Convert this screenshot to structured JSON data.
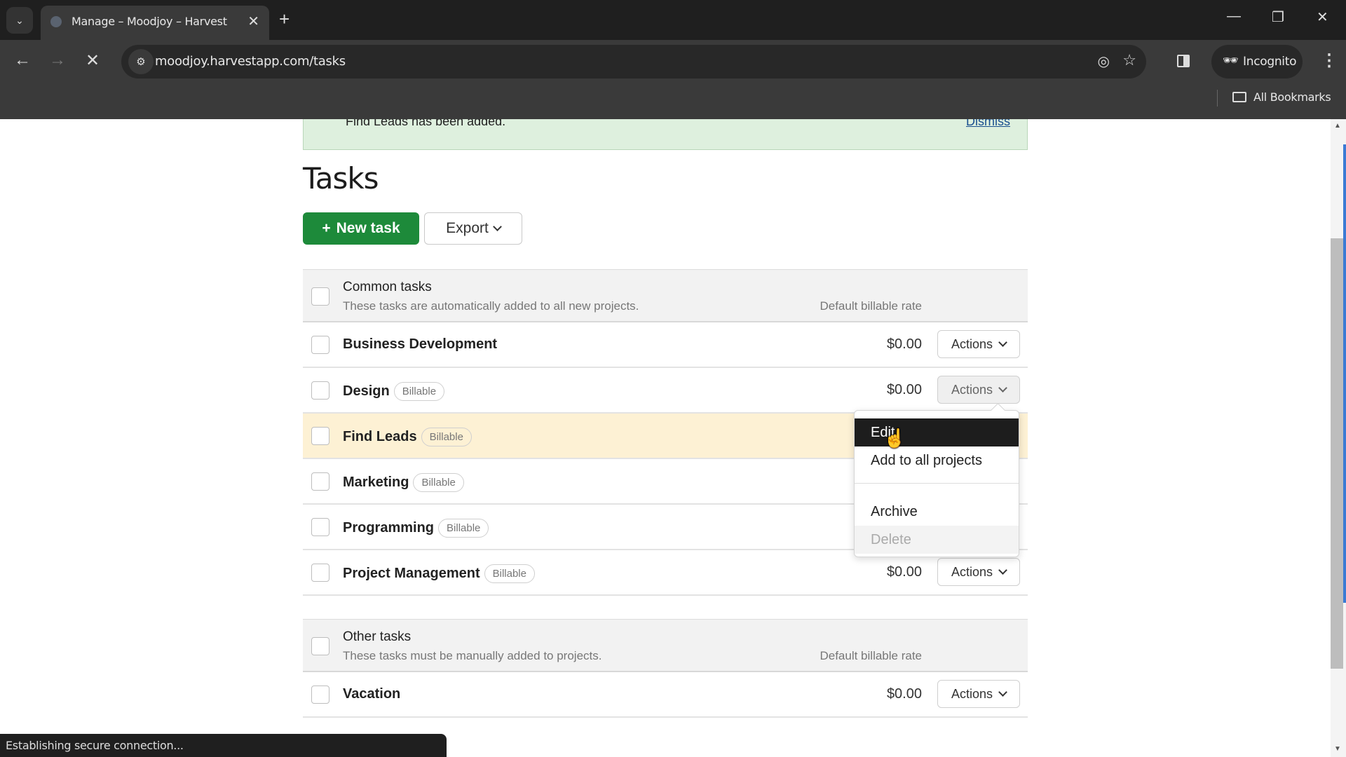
{
  "browser": {
    "tab_title": "Manage – Moodjoy – Harvest",
    "url": "moodjoy.harvestapp.com/tasks",
    "profile_label": "Incognito",
    "bookmarks_label": "All Bookmarks",
    "status_text": "Establishing secure connection..."
  },
  "banner": {
    "message": "Find Leads has been added.",
    "dismiss_label": "Dismiss"
  },
  "page": {
    "title": "Tasks",
    "new_task_label": "New task",
    "export_label": "Export"
  },
  "common_tasks": {
    "title": "Common tasks",
    "description": "These tasks are automatically added to all new projects.",
    "rate_header": "Default billable rate",
    "rows": [
      {
        "name": "Business Development",
        "badge": "",
        "rate": "$0.00",
        "actions": "Actions"
      },
      {
        "name": "Design",
        "badge": "Billable",
        "rate": "$0.00",
        "actions": "Actions"
      },
      {
        "name": "Find Leads",
        "badge": "Billable",
        "rate": "",
        "actions": ""
      },
      {
        "name": "Marketing",
        "badge": "Billable",
        "rate": "",
        "actions": ""
      },
      {
        "name": "Programming",
        "badge": "Billable",
        "rate": "",
        "actions": ""
      },
      {
        "name": "Project Management",
        "badge": "Billable",
        "rate": "$0.00",
        "actions": "Actions"
      }
    ]
  },
  "other_tasks": {
    "title": "Other tasks",
    "description": "These tasks must be manually added to projects.",
    "rate_header": "Default billable rate",
    "rows": [
      {
        "name": "Vacation",
        "badge": "",
        "rate": "$0.00",
        "actions": "Actions"
      }
    ]
  },
  "actions_menu": {
    "items": [
      "Edit",
      "Add to all projects",
      "Archive",
      "Delete"
    ],
    "active_item": "Edit",
    "disabled_item": "Delete"
  },
  "colors": {
    "primary_green": "#1d8a3a",
    "banner_bg": "#def0de",
    "highlight_row": "#fdf1d4"
  }
}
